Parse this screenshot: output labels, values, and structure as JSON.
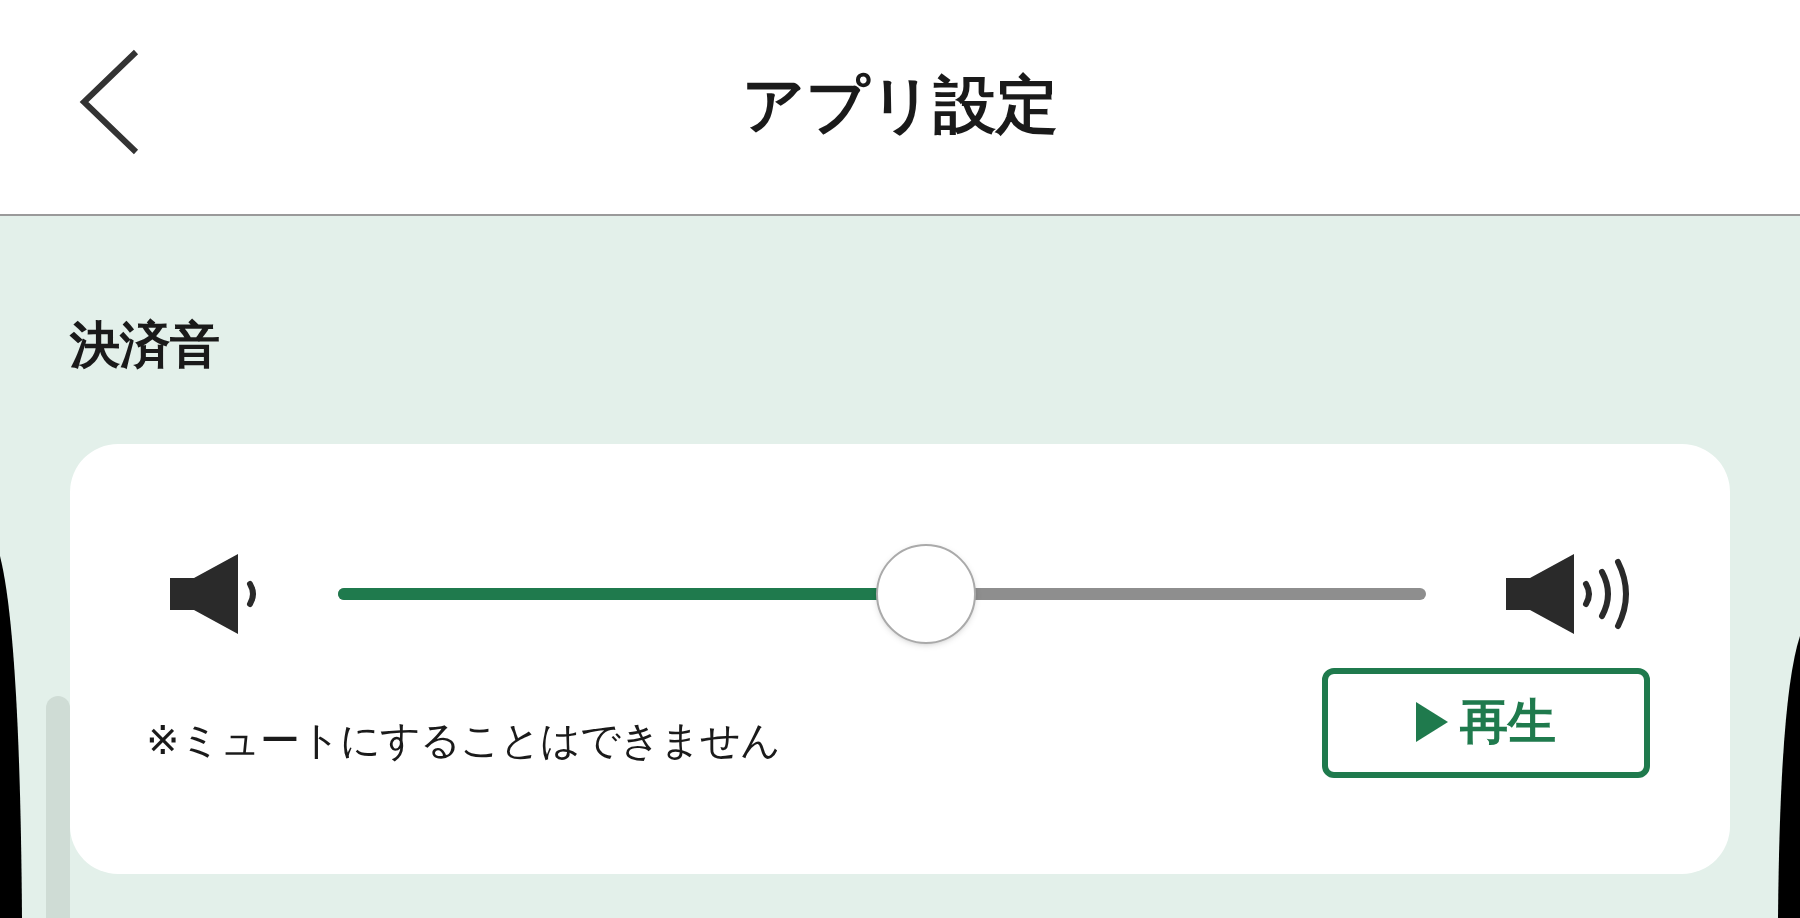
{
  "header": {
    "title": "アプリ設定"
  },
  "section": {
    "title": "決済音"
  },
  "volume": {
    "level": 0.54
  },
  "note": "※ミュートにすることはできません",
  "play_button": {
    "label": "再生"
  }
}
